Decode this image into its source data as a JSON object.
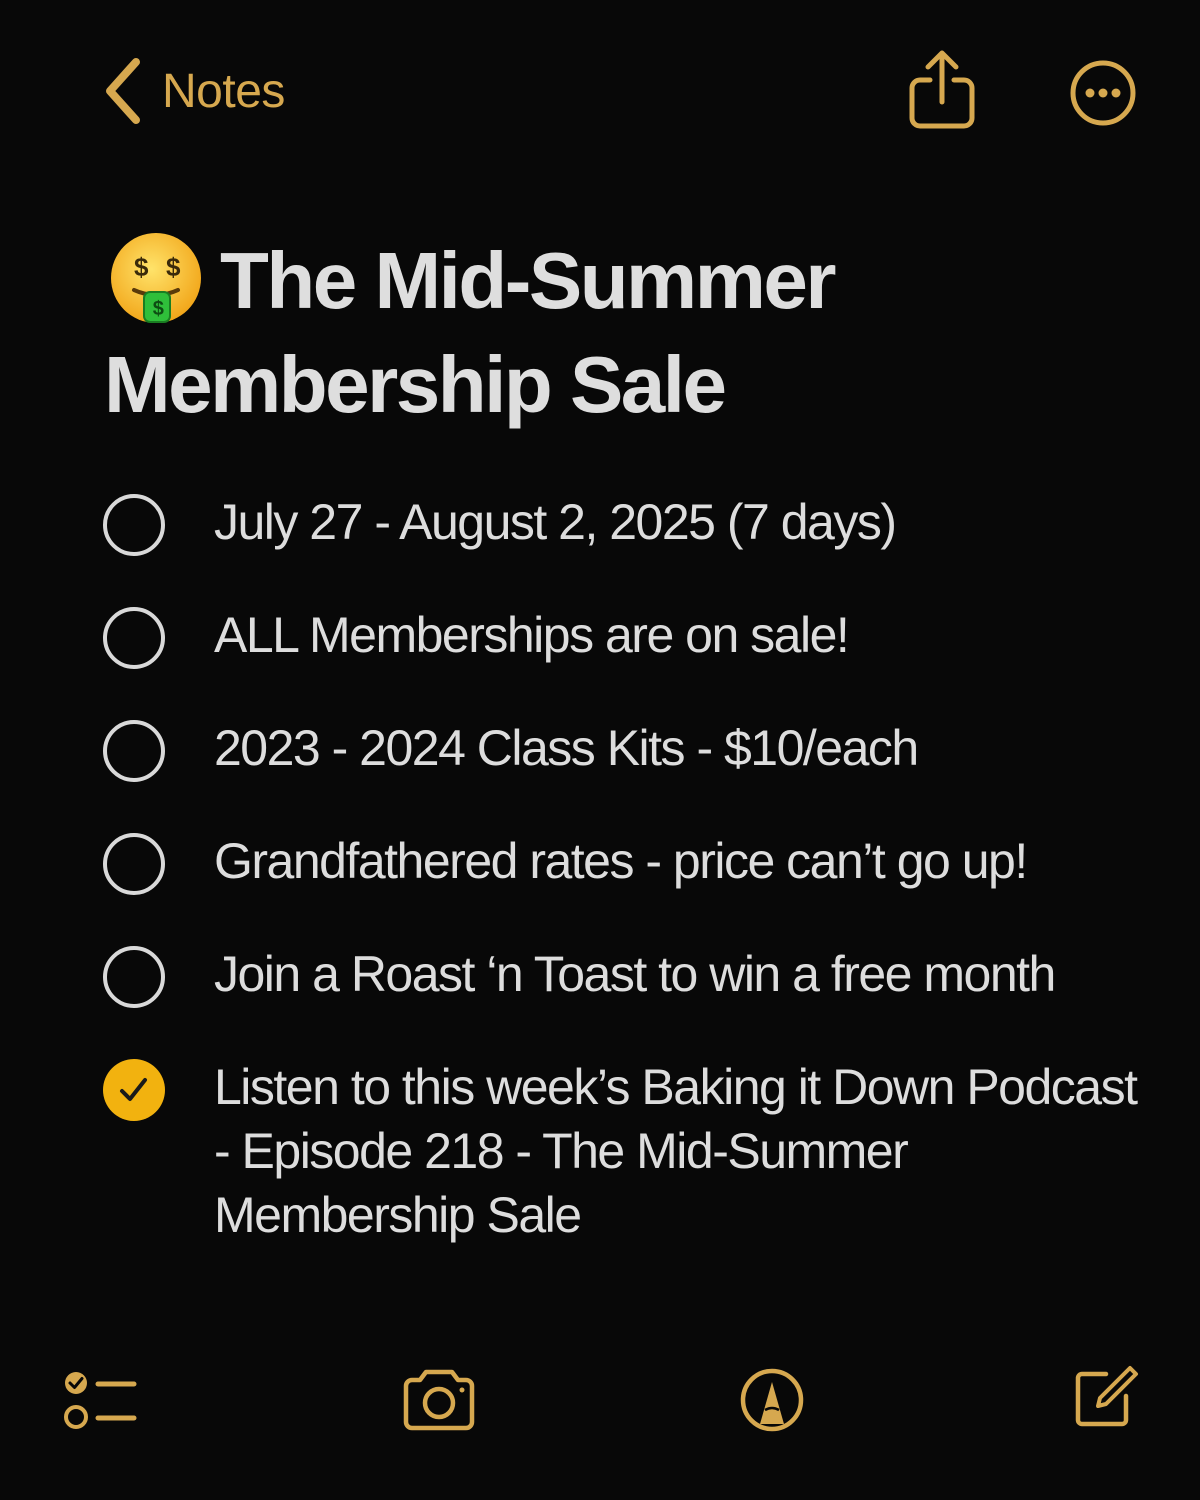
{
  "nav": {
    "back_label": "Notes",
    "accent_color": "#d6a84f"
  },
  "note": {
    "title_emoji": "money-mouth-face-icon",
    "title": "The Mid-Summer Membership Sale",
    "items": [
      {
        "text": "July 27 - August 2, 2025 (7 days)",
        "checked": false
      },
      {
        "text": "ALL Memberships are on sale!",
        "checked": false
      },
      {
        "text": "2023 - 2024 Class Kits - $10/each",
        "checked": false
      },
      {
        "text": "Grandfathered rates - price can’t go up!",
        "checked": false
      },
      {
        "text": "Join a Roast ‘n Toast to win a free month",
        "checked": false
      },
      {
        "text": "Listen to this week’s Baking it Down Podcast - Episode 218 - The Mid-Summer Membership Sale",
        "checked": true
      }
    ],
    "checked_color": "#f2b20f"
  },
  "toolbar": {
    "icons": [
      "checklist-icon",
      "camera-icon",
      "markup-pen-icon",
      "compose-icon"
    ]
  }
}
